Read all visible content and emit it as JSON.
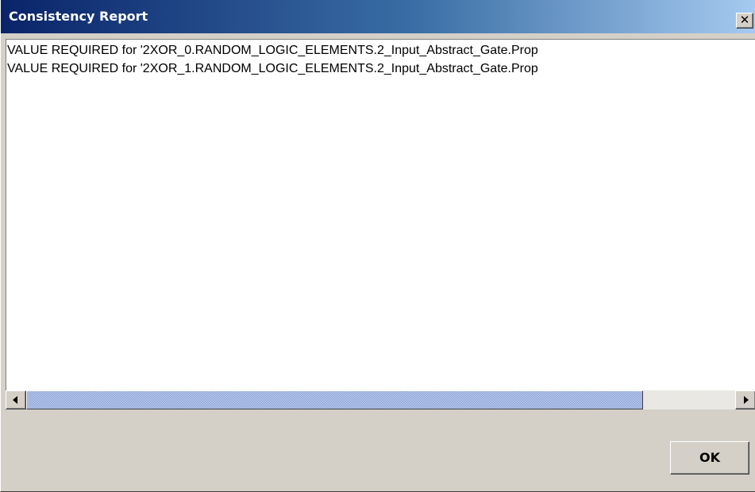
{
  "window": {
    "title": "Consistency Report",
    "close_symbol": "✕",
    "close_icon": "close-icon"
  },
  "report": {
    "lines": [
      "VALUE REQUIRED for '2XOR_0.RANDOM_LOGIC_ELEMENTS.2_Input_Abstract_Gate.Prop",
      "VALUE REQUIRED for '2XOR_1.RANDOM_LOGIC_ELEMENTS.2_Input_Abstract_Gate.Prop"
    ]
  },
  "scrollbar": {
    "horizontal_position_fraction": 0.0,
    "horizontal_visible_fraction": 0.87,
    "left_icon": "arrow-left-icon",
    "right_icon": "arrow-right-icon"
  },
  "buttons": {
    "ok_label": "OK"
  },
  "colors": {
    "title_gradient_start": "#0a246a",
    "title_gradient_end": "#a6caf0",
    "dialog_background": "#d4d0c8",
    "scroll_thumb": "#a6b8e0"
  }
}
